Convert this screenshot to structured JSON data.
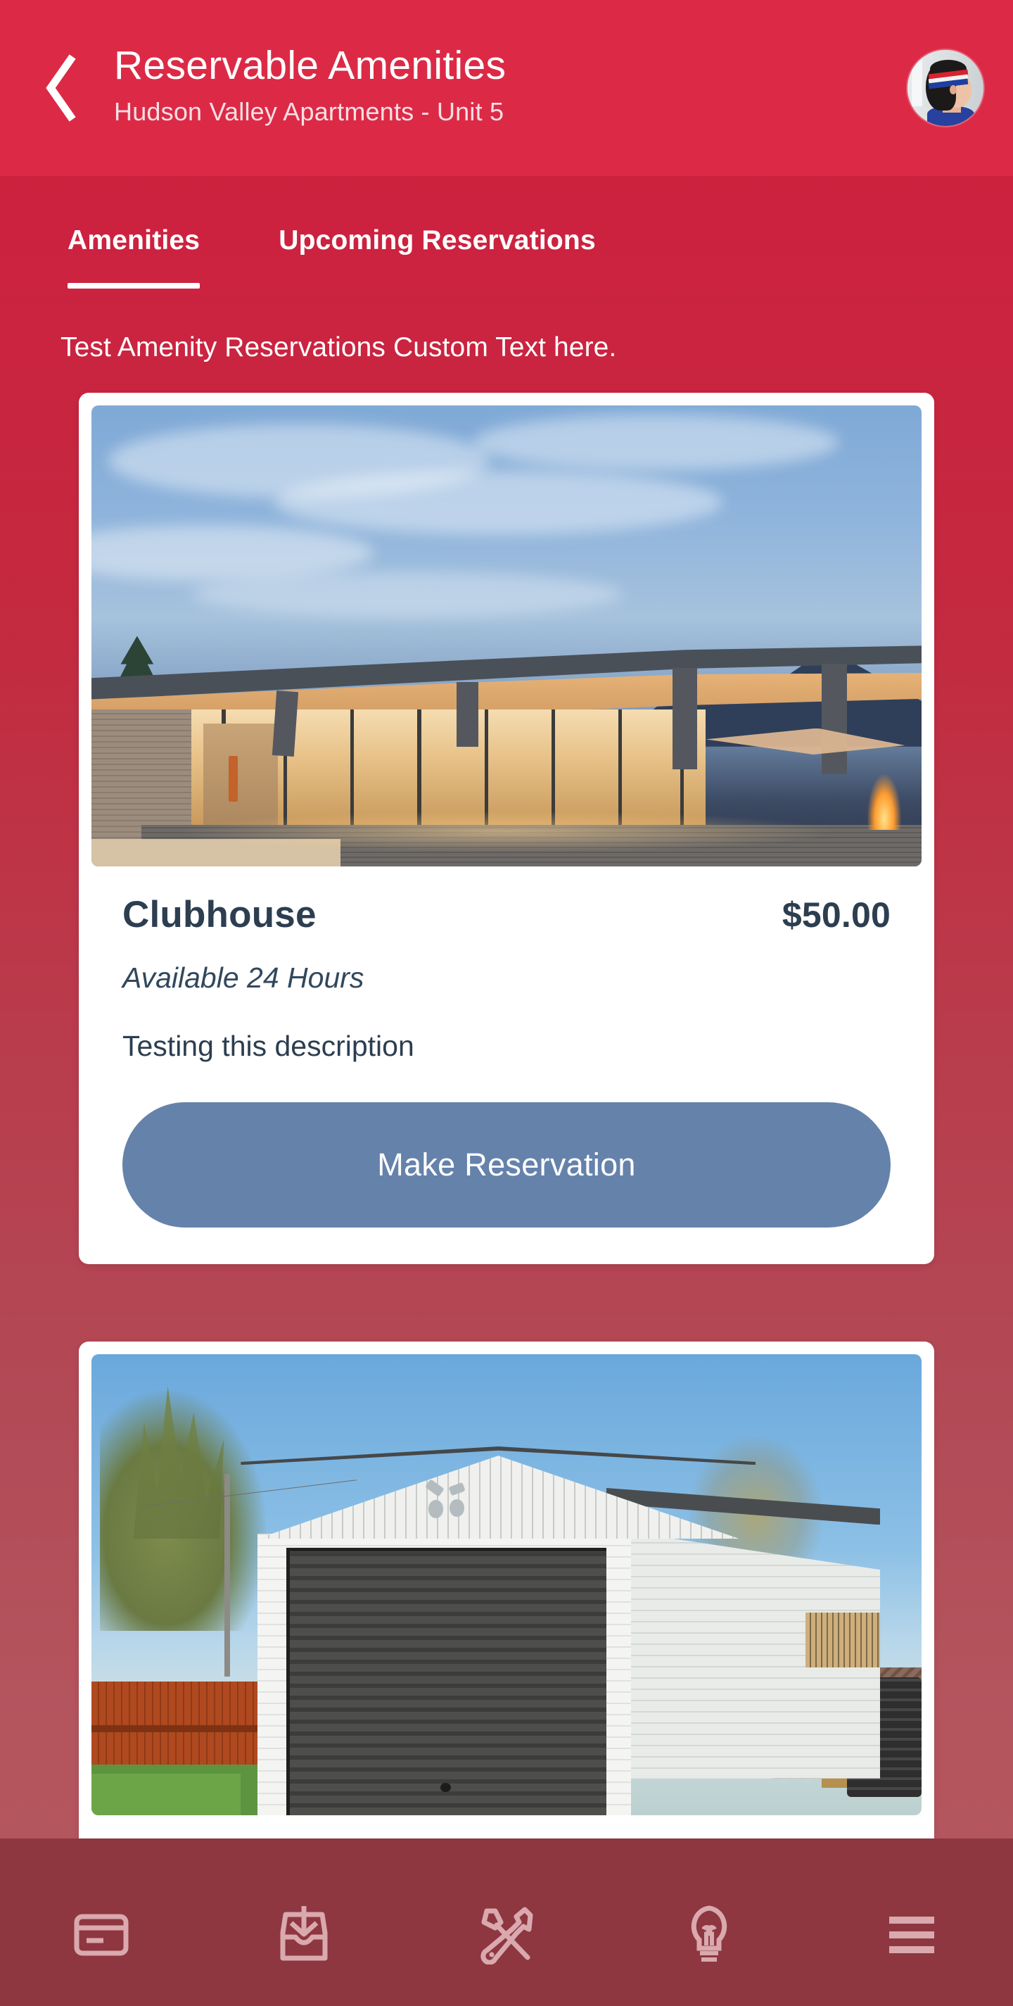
{
  "brand": {
    "header_red": "#dc2a46",
    "body_red_top": "#cf1f3c",
    "body_rose_bottom": "#b5565f",
    "nav_maroon": "#8e3741",
    "button_blue": "#6582ab",
    "text_dark": "#2c3e50"
  },
  "header": {
    "back_icon": "chevron-left-icon",
    "title": "Reservable Amenities",
    "subtitle": "Hudson Valley Apartments - Unit 5",
    "avatar_icon": "avatar"
  },
  "tabs": [
    {
      "label": "Amenities",
      "active": true
    },
    {
      "label": "Upcoming Reservations",
      "active": false
    }
  ],
  "custom_text": "Test Amenity Reservations Custom Text here.",
  "amenities": [
    {
      "image": "clubhouse-photo",
      "title": "Clubhouse",
      "price": "$50.00",
      "availability": "Available 24 Hours",
      "description": "Testing this description",
      "action_label": "Make Reservation"
    },
    {
      "image": "garage-photo",
      "title": "",
      "price": "",
      "availability": "",
      "description": "",
      "action_label": ""
    }
  ],
  "bottom_nav": [
    {
      "icon": "credit-card-icon",
      "name": "payments"
    },
    {
      "icon": "inbox-download-icon",
      "name": "documents"
    },
    {
      "icon": "tools-icon",
      "name": "maintenance"
    },
    {
      "icon": "lightbulb-icon",
      "name": "ideas"
    },
    {
      "icon": "hamburger-menu-icon",
      "name": "menu"
    }
  ]
}
